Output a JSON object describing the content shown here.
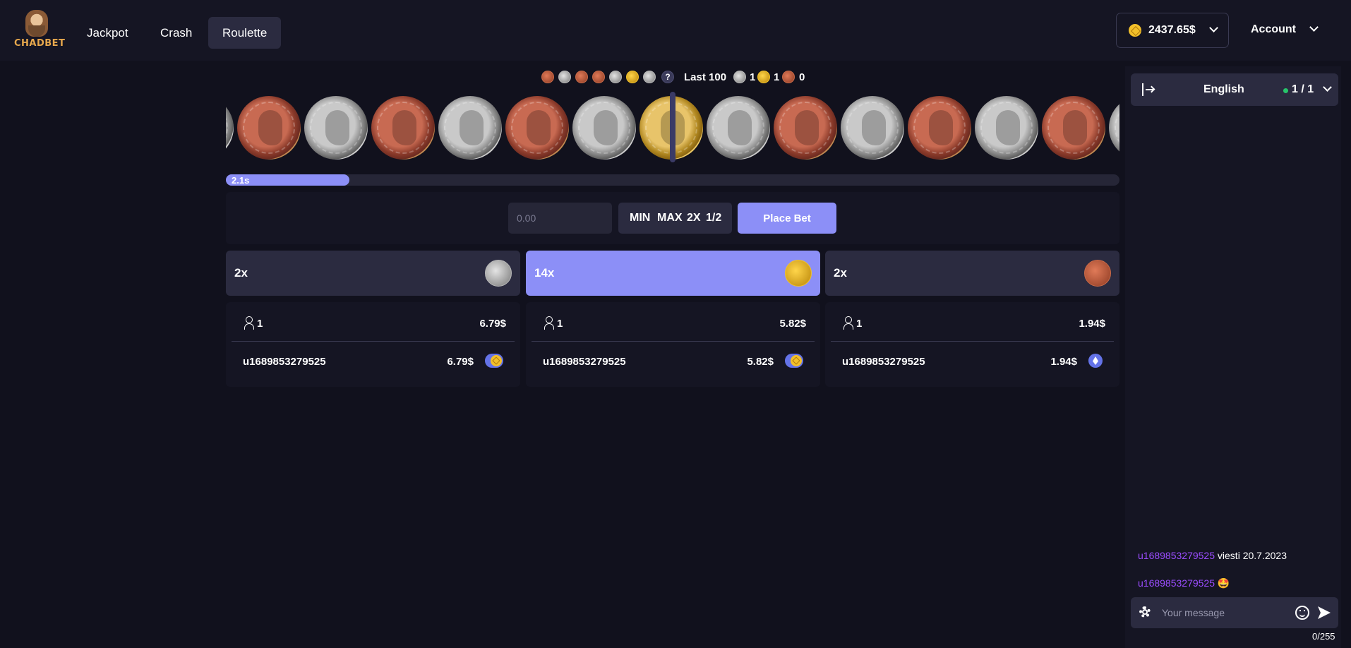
{
  "header": {
    "logo_text": "CHADBET",
    "nav": [
      {
        "label": "Jackpot",
        "active": false
      },
      {
        "label": "Crash",
        "active": false
      },
      {
        "label": "Roulette",
        "active": true
      }
    ],
    "balance": "2437.65$",
    "account_label": "Account"
  },
  "history": {
    "recent": [
      "bronze",
      "silver",
      "bronze",
      "bronze",
      "silver",
      "gold",
      "silver"
    ],
    "unknown_label": "?",
    "last_label": "Last 100",
    "counts": {
      "silver": "1",
      "gold": "1",
      "bronze": "0"
    }
  },
  "reel": [
    "silver",
    "bronze",
    "silver",
    "bronze",
    "silver",
    "bronze",
    "silver",
    "gold",
    "silver",
    "bronze",
    "silver",
    "bronze",
    "silver",
    "bronze",
    "silver"
  ],
  "timer": {
    "label": "2.1s",
    "progress": 0.138
  },
  "bet": {
    "placeholder": "0.00",
    "quick": [
      "MIN",
      "MAX",
      "2X",
      "1/2"
    ],
    "place_label": "Place Bet"
  },
  "columns": [
    {
      "multiplier": "2x",
      "coin": "silver",
      "players": "1",
      "total": "6.79$",
      "bets": [
        {
          "user": "u1689853279525",
          "amount": "6.79$",
          "currency_icon": "bnb-icon"
        }
      ]
    },
    {
      "multiplier": "14x",
      "coin": "gold",
      "players": "1",
      "total": "5.82$",
      "bets": [
        {
          "user": "u1689853279525",
          "amount": "5.82$",
          "currency_icon": "bnb-icon"
        }
      ]
    },
    {
      "multiplier": "2x",
      "coin": "bronze",
      "players": "1",
      "total": "1.94$",
      "bets": [
        {
          "user": "u1689853279525",
          "amount": "1.94$",
          "currency_icon": "eth-icon"
        }
      ]
    }
  ],
  "chat": {
    "language": "English",
    "online": "1 / 1",
    "messages": [
      {
        "user": "u1689853279525",
        "text": "viesti 20.7.2023"
      },
      {
        "user": "u1689853279525",
        "text": "🤩"
      }
    ],
    "placeholder": "Your message",
    "char_count": "0/255"
  },
  "colors": {
    "background": "#11111d",
    "panel": "#151523",
    "card": "#2b2b40",
    "accent": "#8c8ff7",
    "username": "#9b4dff",
    "online": "#27c56a"
  }
}
